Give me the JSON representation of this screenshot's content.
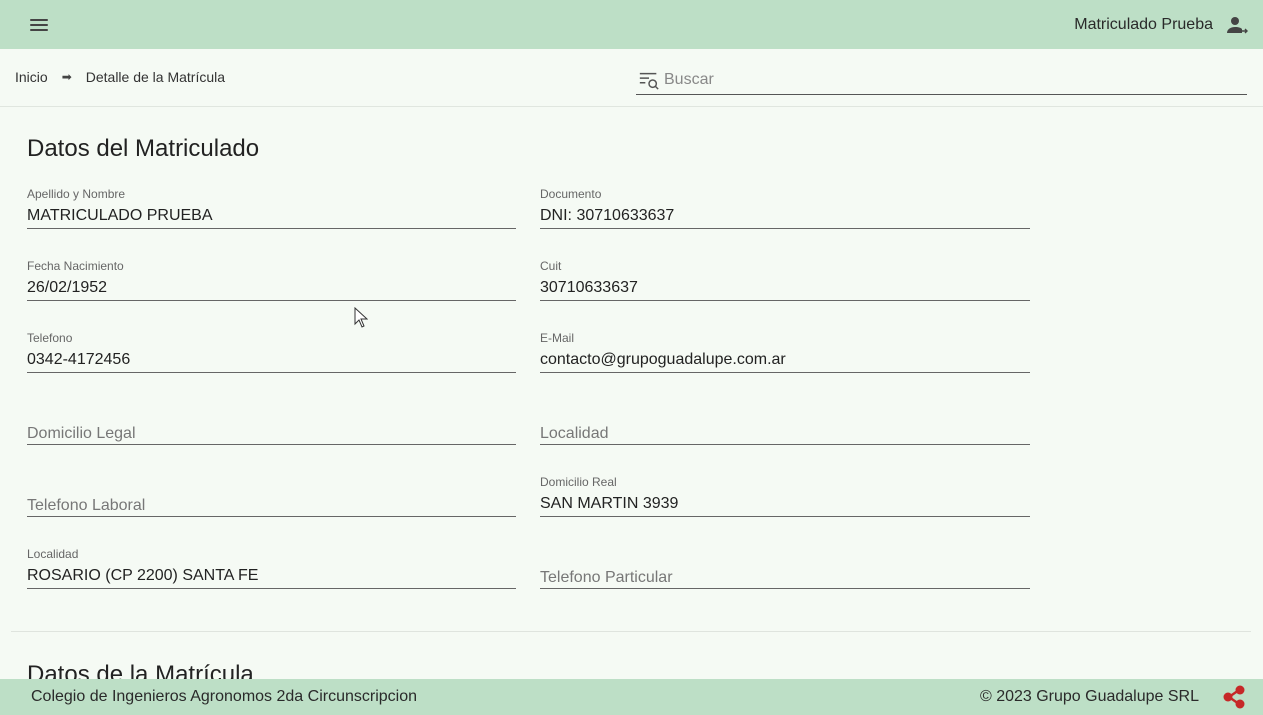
{
  "header": {
    "user_name": "Matriculado Prueba",
    "menu_icon": "menu-icon",
    "user_icon": "user-logout-icon"
  },
  "breadcrumb": {
    "home": "Inicio",
    "current": "Detalle de la Matrícula"
  },
  "search": {
    "placeholder": "Buscar",
    "value": ""
  },
  "section": {
    "title": "Datos del Matriculado",
    "next_title": "Datos de la Matrícula"
  },
  "fields": {
    "apellido_nombre": {
      "label": "Apellido y Nombre",
      "value": "MATRICULADO PRUEBA"
    },
    "documento": {
      "label": "Documento",
      "value": "DNI: 30710633637"
    },
    "fecha_nacimiento": {
      "label": "Fecha Nacimiento",
      "value": "26/02/1952"
    },
    "cuit": {
      "label": "Cuit",
      "value": "30710633637"
    },
    "telefono": {
      "label": "Telefono",
      "value": "0342-4172456"
    },
    "email": {
      "label": "E-Mail",
      "value": "contacto@grupoguadalupe.com.ar"
    },
    "domicilio_legal": {
      "placeholder": "Domicilio Legal"
    },
    "localidad_legal": {
      "placeholder": "Localidad"
    },
    "telefono_laboral": {
      "placeholder": "Telefono Laboral"
    },
    "domicilio_real": {
      "label": "Domicilio Real",
      "value": "SAN MARTIN 3939"
    },
    "localidad": {
      "label": "Localidad",
      "value": "ROSARIO (CP 2200) SANTA FE"
    },
    "telefono_particular": {
      "placeholder": "Telefono Particular"
    }
  },
  "footer": {
    "left": "Colegio de Ingenieros Agronomos 2da Circunscripcion",
    "right": "© 2023 Grupo Guadalupe SRL",
    "brand_icon": "share-icon"
  },
  "colors": {
    "bar": "#bddfc6",
    "background": "#f5faf4",
    "brand": "#c62828"
  }
}
